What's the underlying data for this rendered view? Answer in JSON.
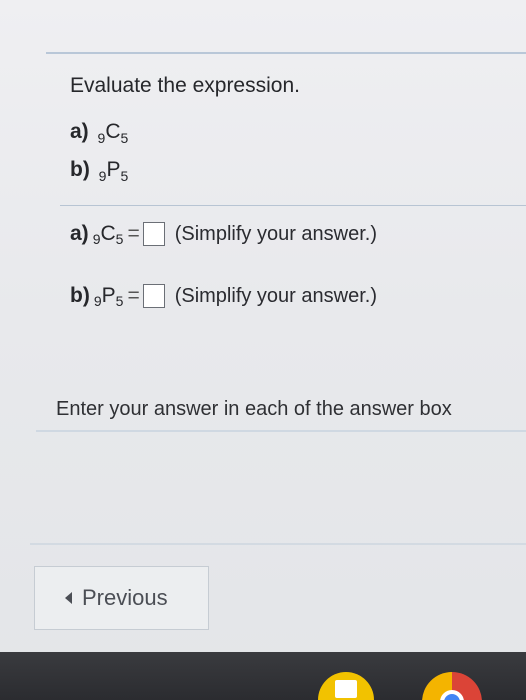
{
  "question": {
    "prompt": "Evaluate the expression.",
    "parts": [
      {
        "label": "a)",
        "lead": "9",
        "letter": "C",
        "sub": "5"
      },
      {
        "label": "b)",
        "lead": "9",
        "letter": "P",
        "sub": "5"
      }
    ]
  },
  "answers": [
    {
      "label": "a)",
      "lead": "9",
      "letter": "C",
      "sub": "5",
      "equals": "=",
      "value": "",
      "hint": "(Simplify your answer.)"
    },
    {
      "label": "b)",
      "lead": "9",
      "letter": "P",
      "sub": "5",
      "equals": "=",
      "value": "",
      "hint": "(Simplify your answer.)"
    }
  ],
  "footer": {
    "enter_message": "Enter your answer in each of the answer box",
    "previous_label": "Previous"
  },
  "taskbar": {
    "icons": [
      "docs-icon",
      "chrome-icon"
    ]
  }
}
